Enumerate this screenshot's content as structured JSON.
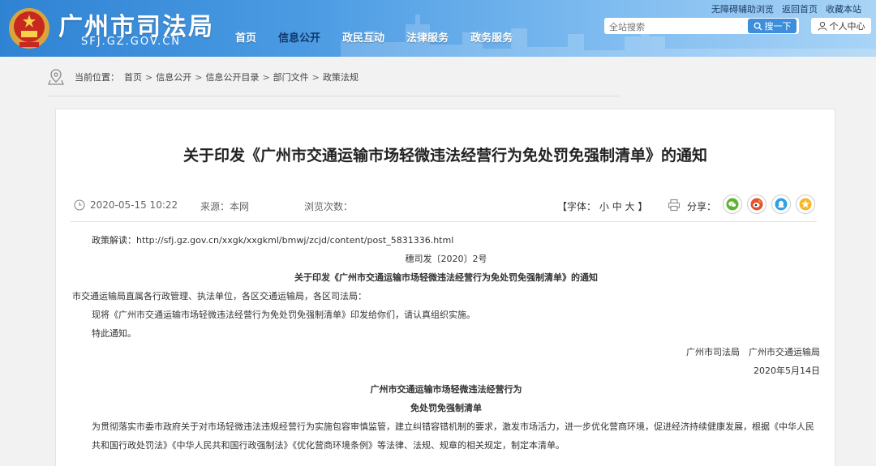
{
  "header": {
    "site_name": "广州市司法局",
    "site_domain": "SFJ.GZ.GOV.CN",
    "nav": [
      "首页",
      "信息公开",
      "政民互动",
      "法律服务",
      "政务服务"
    ],
    "nav_active_index": 1,
    "util_links": [
      "无障碍辅助浏览",
      "返回首页",
      "收藏本站"
    ],
    "search_placeholder": "全站搜索",
    "search_button": "搜一下",
    "user_center": "个人中心",
    "colors": {
      "header_start": "#2f83d3",
      "header_end": "#a9d4f6",
      "active_nav": "#12366b"
    }
  },
  "breadcrumb": {
    "label": "当前位置：",
    "items": [
      "首页",
      "信息公开",
      "信息公开目录",
      "部门文件",
      "政策法规"
    ],
    "separator": ">"
  },
  "article": {
    "title": "关于印发《广州市交通运输市场轻微违法经营行为免处罚免强制清单》的通知",
    "date": "2020-05-15 10:22",
    "source": "来源：本网",
    "views": "浏览次数：",
    "font_label": "【字体：",
    "font_small": "小",
    "font_medium": "中",
    "font_large": "大",
    "font_close": "】",
    "share_label": "分享：",
    "share_icons": [
      "wechat-icon",
      "weibo-icon",
      "qq-icon",
      "favorite-icon"
    ],
    "body": {
      "policy_link": "政策解读：http://sfj.gz.gov.cn/xxgk/xxgkml/bmwj/zcjd/content/post_5831336.html",
      "doc_number": "穗司发〔2020〕2号",
      "notice_title": "关于印发《广州市交通运输市场轻微违法经营行为免处罚免强制清单》的通知",
      "recipients": "市交通运输局直属各行政管理、执法单位，各区交通运输局，各区司法局：",
      "para1": "现将《广州市交通运输市场轻微违法经营行为免处罚免强制清单》印发给你们，请认真组织实施。",
      "para2": "特此通知。",
      "signatories": "广州市司法局　广州市交通运输局",
      "sign_date": "2020年5月14日",
      "list_title_1": "广州市交通运输市场轻微违法经营行为",
      "list_title_2": "免处罚免强制清单",
      "para3": "为贯彻落实市委市政府关于对市场轻微违法违规经营行为实施包容审慎监管，建立纠错容错机制的要求，激发市场活力，进一步优化营商环境，促进经济持续健康发展，根据《中华人民共和国行政处罚法》《中华人民共和国行政强制法》《优化营商环境条例》等法律、法规、规章的相关规定，制定本清单。"
    }
  }
}
